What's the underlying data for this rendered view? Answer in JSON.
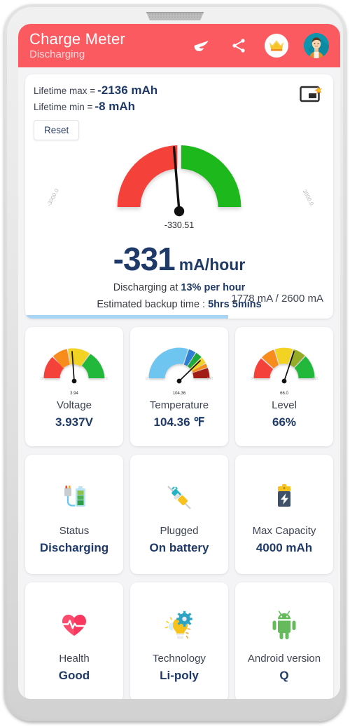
{
  "appbar": {
    "title": "Charge Meter",
    "subtitle": "Discharging",
    "actions": [
      {
        "name": "night-mode-icon",
        "label": "Night mode"
      },
      {
        "name": "share-icon",
        "label": "Share"
      },
      {
        "name": "crown-icon",
        "label": "Premium"
      },
      {
        "name": "avatar",
        "label": "Account"
      }
    ],
    "bg_color": "#fb5a60"
  },
  "meter_card": {
    "lifetime_max_label": "Lifetime max =",
    "lifetime_max_value": "-2136 mAh",
    "lifetime_min_label": "Lifetime min =",
    "lifetime_min_value": "-8 mAh",
    "reset_label": "Reset",
    "pip_icon": "picture-in-picture-icon",
    "gauge": {
      "min_label": "-3000.0",
      "max_label": "3000.0",
      "needle_value": "-330.51",
      "min": -3000,
      "max": 3000,
      "value": -330.51,
      "segments": [
        {
          "color": "#f44336",
          "from": -3000,
          "to": 0
        },
        {
          "color": "#1db81d",
          "from": 0,
          "to": 3000
        }
      ]
    },
    "big_number": "-331",
    "big_unit": "mA/hour",
    "discharge_prefix": "Discharging at ",
    "discharge_rate": "13% per hour",
    "backup_prefix": "Estimated backup time : ",
    "backup_value": "5hrs 5mins",
    "capacity_text": "1778 mA / 2600 mA",
    "capacity_current": 1778,
    "capacity_total": 2600,
    "capacity_percent": 66,
    "capacity_bar_color": "#a8d4f5"
  },
  "tiles": [
    {
      "name": "voltage",
      "label": "Voltage",
      "value": "3.937V",
      "kind": "gauge",
      "gauge": {
        "needle_value": "3.94",
        "min_label": "0",
        "max_label": "5",
        "needle_pct": 46,
        "segments": [
          {
            "color": "#f4433a",
            "span": 22
          },
          {
            "color": "#f78c1b",
            "span": 19
          },
          {
            "color": "#f2d220",
            "span": 33
          },
          {
            "color": "#22b83a",
            "span": 26
          }
        ]
      }
    },
    {
      "name": "temperature",
      "label": "Temperature",
      "value": "104.36 ℉",
      "kind": "gauge",
      "gauge": {
        "needle_value": "104.36",
        "min_label": "0",
        "max_label": "140",
        "needle_pct": 82,
        "segments": [
          {
            "color": "#6ec6f0",
            "span": 57
          },
          {
            "color": "#2f7fd1",
            "span": 8
          },
          {
            "color": "#1eaa3c",
            "span": 8
          },
          {
            "color": "#f2d220",
            "span": 8
          },
          {
            "color": "#f78c1b",
            "span": 5
          },
          {
            "color": "#a21f16",
            "span": 14
          }
        ]
      }
    },
    {
      "name": "level",
      "label": "Level",
      "value": "66%",
      "kind": "gauge",
      "gauge": {
        "needle_value": "66.0",
        "min_label": "0",
        "max_label": "100",
        "needle_pct": 66,
        "segments": [
          {
            "color": "#f4433a",
            "span": 20
          },
          {
            "color": "#f78c1b",
            "span": 17
          },
          {
            "color": "#f2d220",
            "span": 22
          },
          {
            "color": "#95ac28",
            "span": 17
          },
          {
            "color": "#22b83a",
            "span": 24
          }
        ]
      }
    },
    {
      "name": "status",
      "label": "Status",
      "value": "Discharging",
      "kind": "icon",
      "icon": "battery-plug-icon"
    },
    {
      "name": "plugged",
      "label": "Plugged",
      "value": "On battery",
      "kind": "icon",
      "icon": "unplugged-icon"
    },
    {
      "name": "max-capacity",
      "label": "Max Capacity",
      "value": "4000 mAh",
      "kind": "icon",
      "icon": "battery-bolt-icon"
    },
    {
      "name": "health",
      "label": "Health",
      "value": "Good",
      "kind": "icon",
      "icon": "heart-pulse-icon"
    },
    {
      "name": "technology",
      "label": "Technology",
      "value": "Li-poly",
      "kind": "icon",
      "icon": "lightbulb-gear-icon"
    },
    {
      "name": "android-version",
      "label": "Android version",
      "value": "Q",
      "kind": "icon",
      "icon": "android-robot-icon"
    }
  ]
}
